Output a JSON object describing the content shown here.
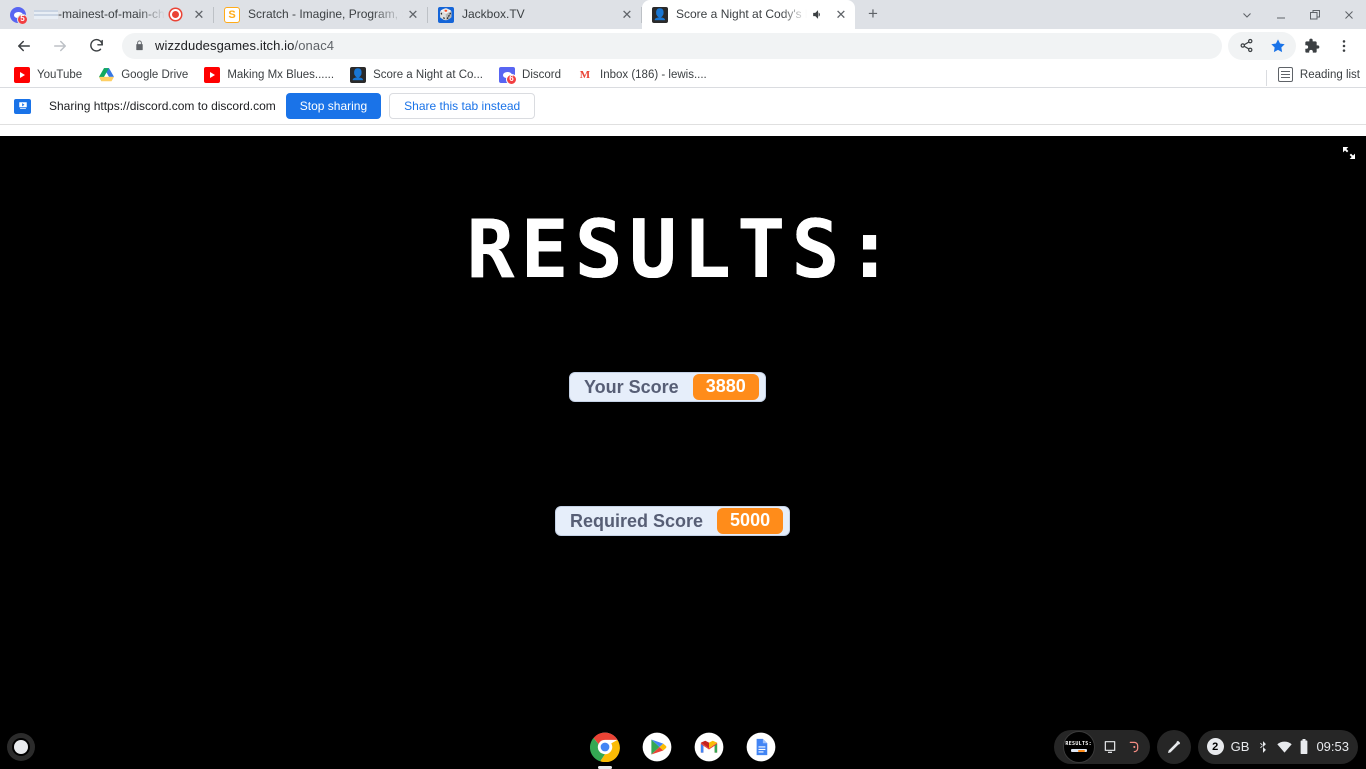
{
  "window": {
    "controls": {
      "tab_search": "chevron-down",
      "minimize": "minimize",
      "maximize": "maximize",
      "close": "close"
    }
  },
  "tabs": [
    {
      "title": "-mainest-of-main-chats",
      "favicon": "discord-icon",
      "badge": "5",
      "redacted_prefix": true,
      "recording": true,
      "active": false
    },
    {
      "title": "Scratch - Imagine, Program, Sha",
      "favicon": "scratch-icon",
      "active": false
    },
    {
      "title": "Jackbox.TV",
      "favicon": "jackbox-icon",
      "active": false
    },
    {
      "title": "Score a Night at Cody's by W",
      "favicon": "game-icon",
      "audio": true,
      "active": true
    }
  ],
  "newtab_label": "+",
  "toolbar": {
    "back": "back-arrow",
    "forward": "forward-arrow",
    "reload": "reload",
    "lock": "lock-icon",
    "url_host": "wizzdudesgames.itch.io",
    "url_path": "/onac4",
    "share": "share-icon",
    "bookmark_star": "star-icon",
    "extensions": "puzzle-icon",
    "menu": "three-dot-icon"
  },
  "bookmarks": {
    "items": [
      {
        "label": "YouTube",
        "icon": "youtube-icon"
      },
      {
        "label": "Google Drive",
        "icon": "google-drive-icon"
      },
      {
        "label": "Making Mx Blues......",
        "icon": "youtube-icon"
      },
      {
        "label": "Score a Night at Co...",
        "icon": "game-icon"
      },
      {
        "label": "Discord",
        "icon": "discord-icon",
        "badge": "6"
      },
      {
        "label": "Inbox (186) - lewis....",
        "icon": "gmail-icon"
      }
    ],
    "reading_list": "Reading list"
  },
  "infobar": {
    "icon": "screen-share-icon",
    "text": "Sharing https://discord.com to discord.com",
    "stop_label": "Stop sharing",
    "share_instead_label": "Share this tab instead"
  },
  "game": {
    "fullscreen_icon": "fullscreen-icon",
    "title": "RESULTS:",
    "watchers": [
      {
        "label": "Your Score",
        "value": "3880"
      },
      {
        "label": "Required Score",
        "value": "5000"
      }
    ],
    "accent_color": "#ff8c1a",
    "watcher_bg": "#e6eefa",
    "watcher_text": "#575e75",
    "background": "#000000"
  },
  "shelf": {
    "launcher": "launcher-icon",
    "apps": [
      {
        "name": "chrome-icon",
        "active": true
      },
      {
        "name": "play-store-icon",
        "active": false
      },
      {
        "name": "gmail-icon",
        "active": false
      },
      {
        "name": "docs-icon",
        "active": false
      }
    ],
    "share_thumb_title": "RESULTS:",
    "cast_icon": "screen-cast-icon",
    "stop_record_icon": "stop-record-icon",
    "stylus_icon": "stylus-icon",
    "tray": {
      "notification_count": "2",
      "keyboard_layout": "GB",
      "bluetooth": "bluetooth-icon",
      "wifi": "wifi-icon",
      "battery": "battery-icon",
      "time": "09:53"
    }
  }
}
